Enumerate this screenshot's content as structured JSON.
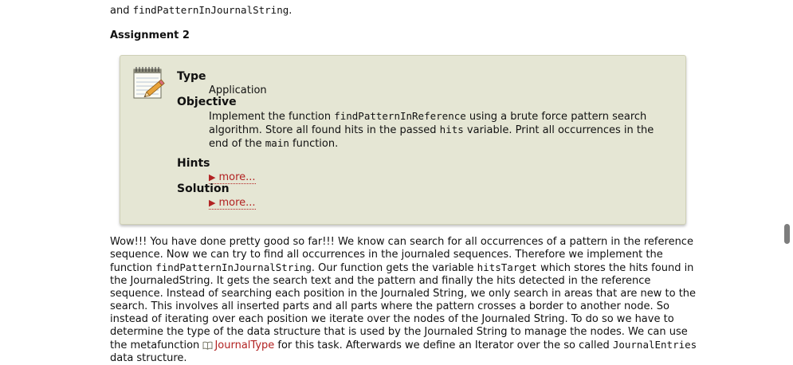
{
  "top": {
    "text_prefix": "and ",
    "code": "findPatternInJournalString",
    "text_suffix": "."
  },
  "assignment": {
    "title": "Assignment 2",
    "type_label": "Type",
    "type_value": "Application",
    "objective_label": "Objective",
    "objective": {
      "p1": "Implement the function ",
      "code1": "findPatternInReference",
      "p2": " using a brute force pattern search algorithm. Store all found hits in the passed ",
      "code2": "hits",
      "p3": " variable. Print all occurrences in the end of the ",
      "code3": "main",
      "p4": " function."
    },
    "hints_label": "Hints",
    "hints_more": "more...",
    "solution_label": "Solution",
    "solution_more": "more...",
    "icon": "notepad-pencil-icon"
  },
  "body": {
    "t1": "Wow!!! You have done pretty good so far!!! We know can search for all occurrences of a pattern in the reference sequence. Now we can try to find all occurrences in the journaled sequences. Therefore we implement the function ",
    "code1": "findPatternInJournalString",
    "t2": ". Our function gets the variable ",
    "code2": "hitsTarget",
    "t3": " which stores the hits found in the JournaledString. It gets the search text and the pattern and finally the hits detected in the reference sequence. Instead of searching each position in the Journaled String, we only search in areas that are new to the search. This involves all inserted parts and all parts where the pattern crosses a border to another node. So instead of iterating over each position we iterate over the nodes of the Journaled String. To do so we have to determine the type of the data structure that is used by the Journaled String to manage the nodes. We can use the metafunction ",
    "link": "JournalType",
    "t4": " for this task. Afterwards we define an Iterator over the so called ",
    "code3": "JournalEntries",
    "t5": " data structure.",
    "link_color": "#b22222"
  },
  "colors": {
    "box_background": "#e5e6d4",
    "box_border": "#cfd0b6",
    "more_link": "#b22222"
  }
}
